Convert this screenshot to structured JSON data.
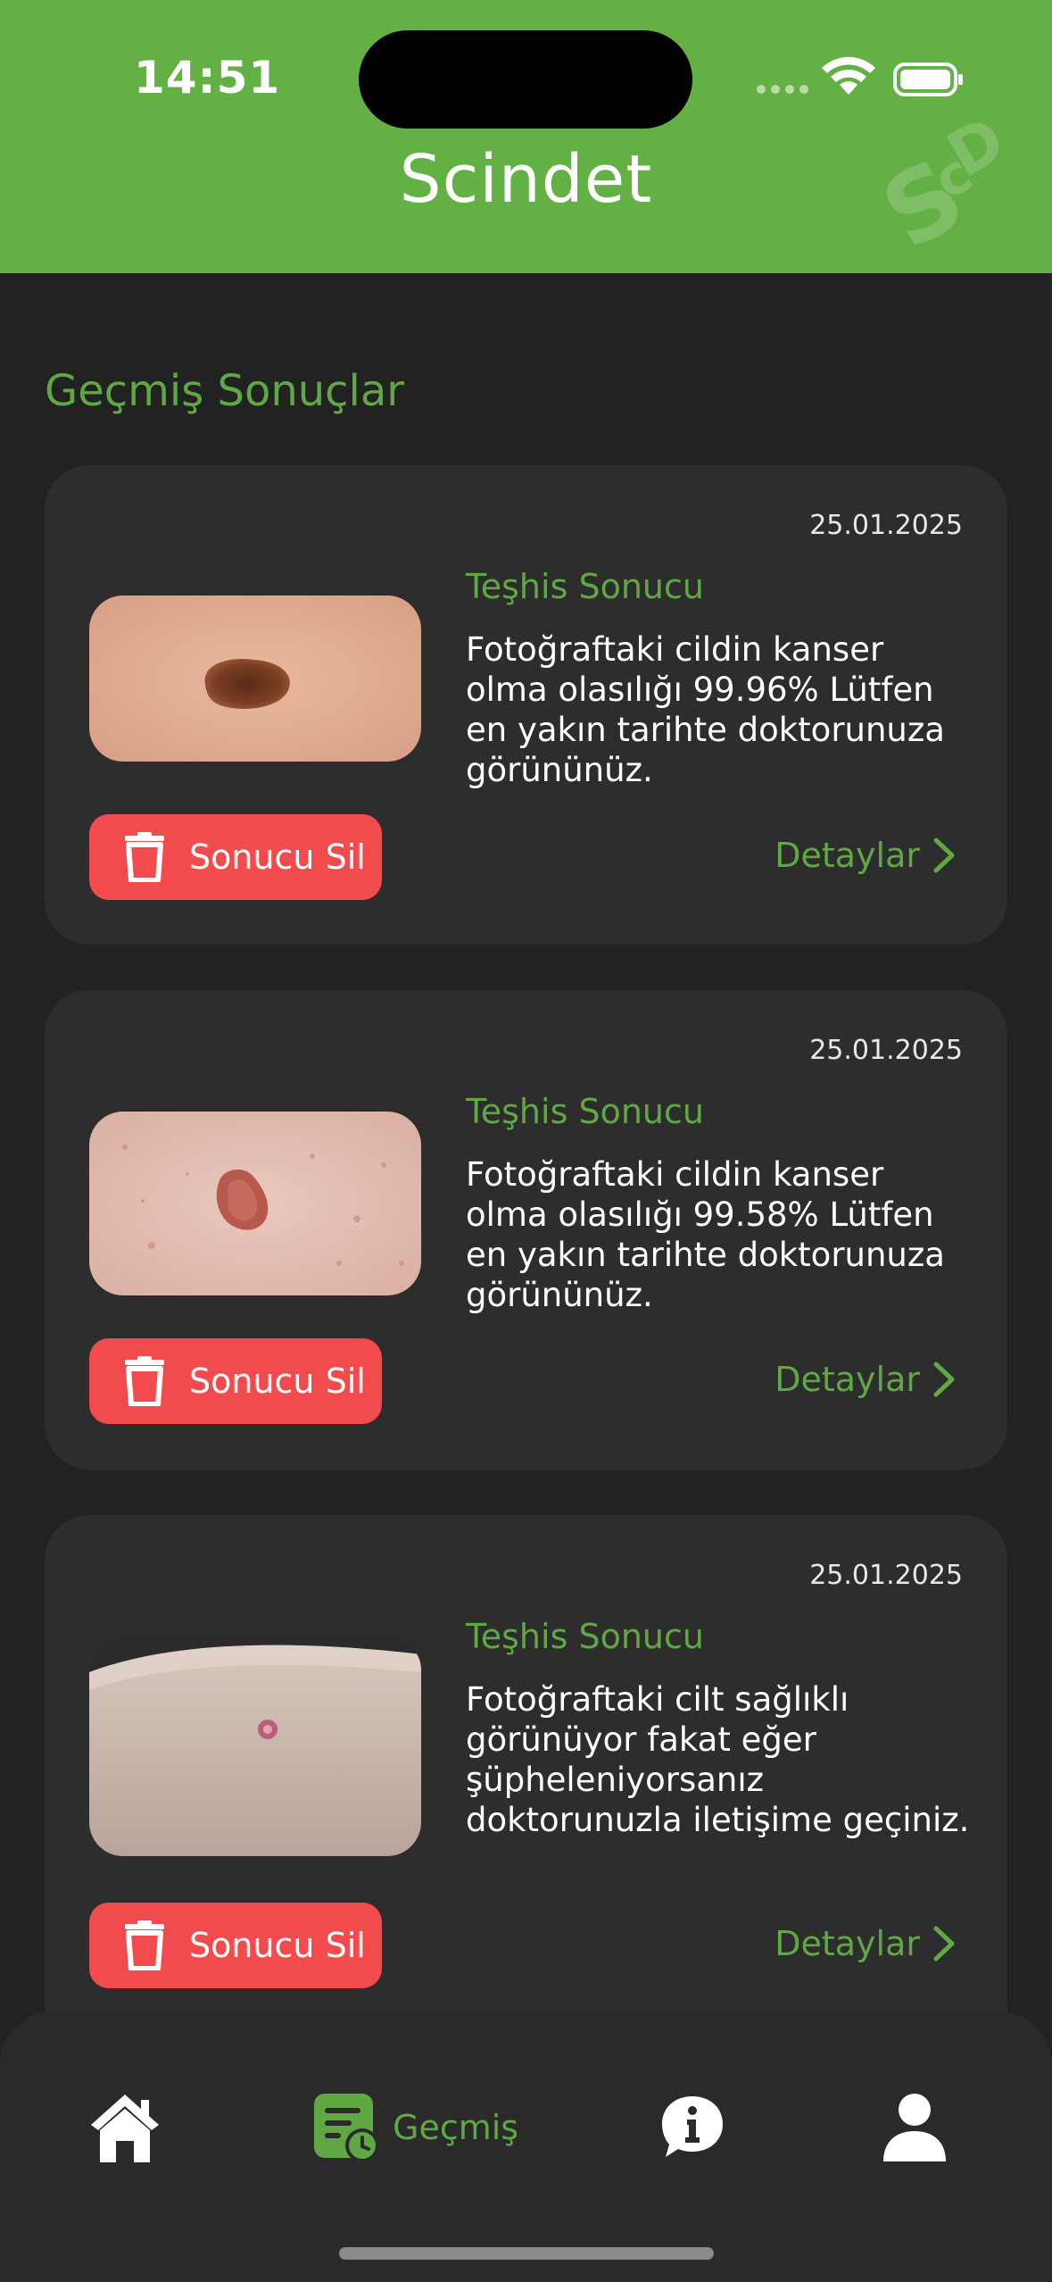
{
  "status": {
    "time": "14:51"
  },
  "header": {
    "title": "Scindet",
    "logo_text": "ScD"
  },
  "section_title": "Geçmiş Sonuçlar",
  "results": [
    {
      "date": "25.01.2025",
      "label": "Teşhis Sonucu",
      "text": "Fotoğraftaki cildin kanser olma olasılığı 99.96% Lütfen en yakın tarihte doktorunuza görününüz.",
      "delete_label": "Sonucu Sil",
      "details_label": "Detaylar"
    },
    {
      "date": "25.01.2025",
      "label": "Teşhis Sonucu",
      "text": "Fotoğraftaki cildin kanser olma olasılığı 99.58% Lütfen en yakın tarihte doktorunuza görününüz.",
      "delete_label": "Sonucu Sil",
      "details_label": "Detaylar"
    },
    {
      "date": "25.01.2025",
      "label": "Teşhis Sonucu",
      "text": "Fotoğraftaki cilt sağlıklı görünüyor fakat eğer şüpheleniyorsanız doktorunuzla iletişime geçiniz.",
      "delete_label": "Sonucu Sil",
      "details_label": "Detaylar"
    }
  ],
  "nav": {
    "items": [
      {
        "icon": "home-icon",
        "label": ""
      },
      {
        "icon": "history-icon",
        "label": "Geçmiş",
        "active": true
      },
      {
        "icon": "info-icon",
        "label": ""
      },
      {
        "icon": "profile-icon",
        "label": ""
      }
    ]
  },
  "colors": {
    "brand_green": "#63b045",
    "accent_green": "#5fa843",
    "delete_red": "#f24b4d",
    "background": "#222222",
    "card": "#2d2d2d"
  }
}
